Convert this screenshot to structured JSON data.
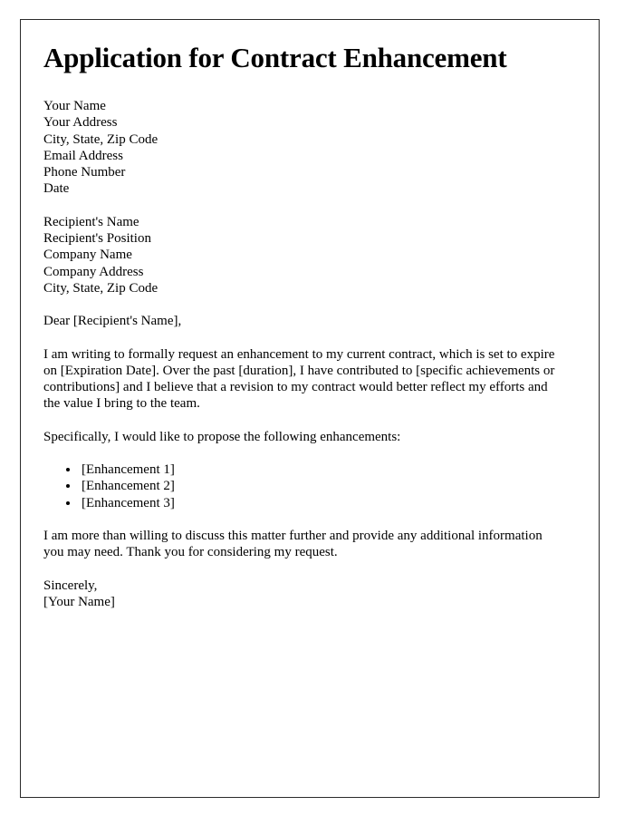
{
  "document": {
    "title": "Application for Contract Enhancement",
    "sender_block": [
      "Your Name",
      "Your Address",
      "City, State, Zip Code",
      "Email Address",
      "Phone Number",
      "Date"
    ],
    "recipient_block": [
      "Recipient's Name",
      "Recipient's Position",
      "Company Name",
      "Company Address",
      "City, State, Zip Code"
    ],
    "salutation": "Dear [Recipient's Name],",
    "paragraph_1": "I am writing to formally request an enhancement to my current contract, which is set to expire on [Expiration Date]. Over the past [duration], I have contributed to [specific achievements or contributions] and I believe that a revision to my contract would better reflect my efforts and the value I bring to the team.",
    "paragraph_2": "Specifically, I would like to propose the following enhancements:",
    "enhancements": [
      "[Enhancement 1]",
      "[Enhancement 2]",
      "[Enhancement 3]"
    ],
    "paragraph_3": "I am more than willing to discuss this matter further and provide any additional information you may need. Thank you for considering my request.",
    "closing": "Sincerely,",
    "signature": "[Your Name]"
  },
  "style": {
    "text_color": "#000000",
    "border_color": "#2b2b2b",
    "page_background": "#ffffff"
  }
}
